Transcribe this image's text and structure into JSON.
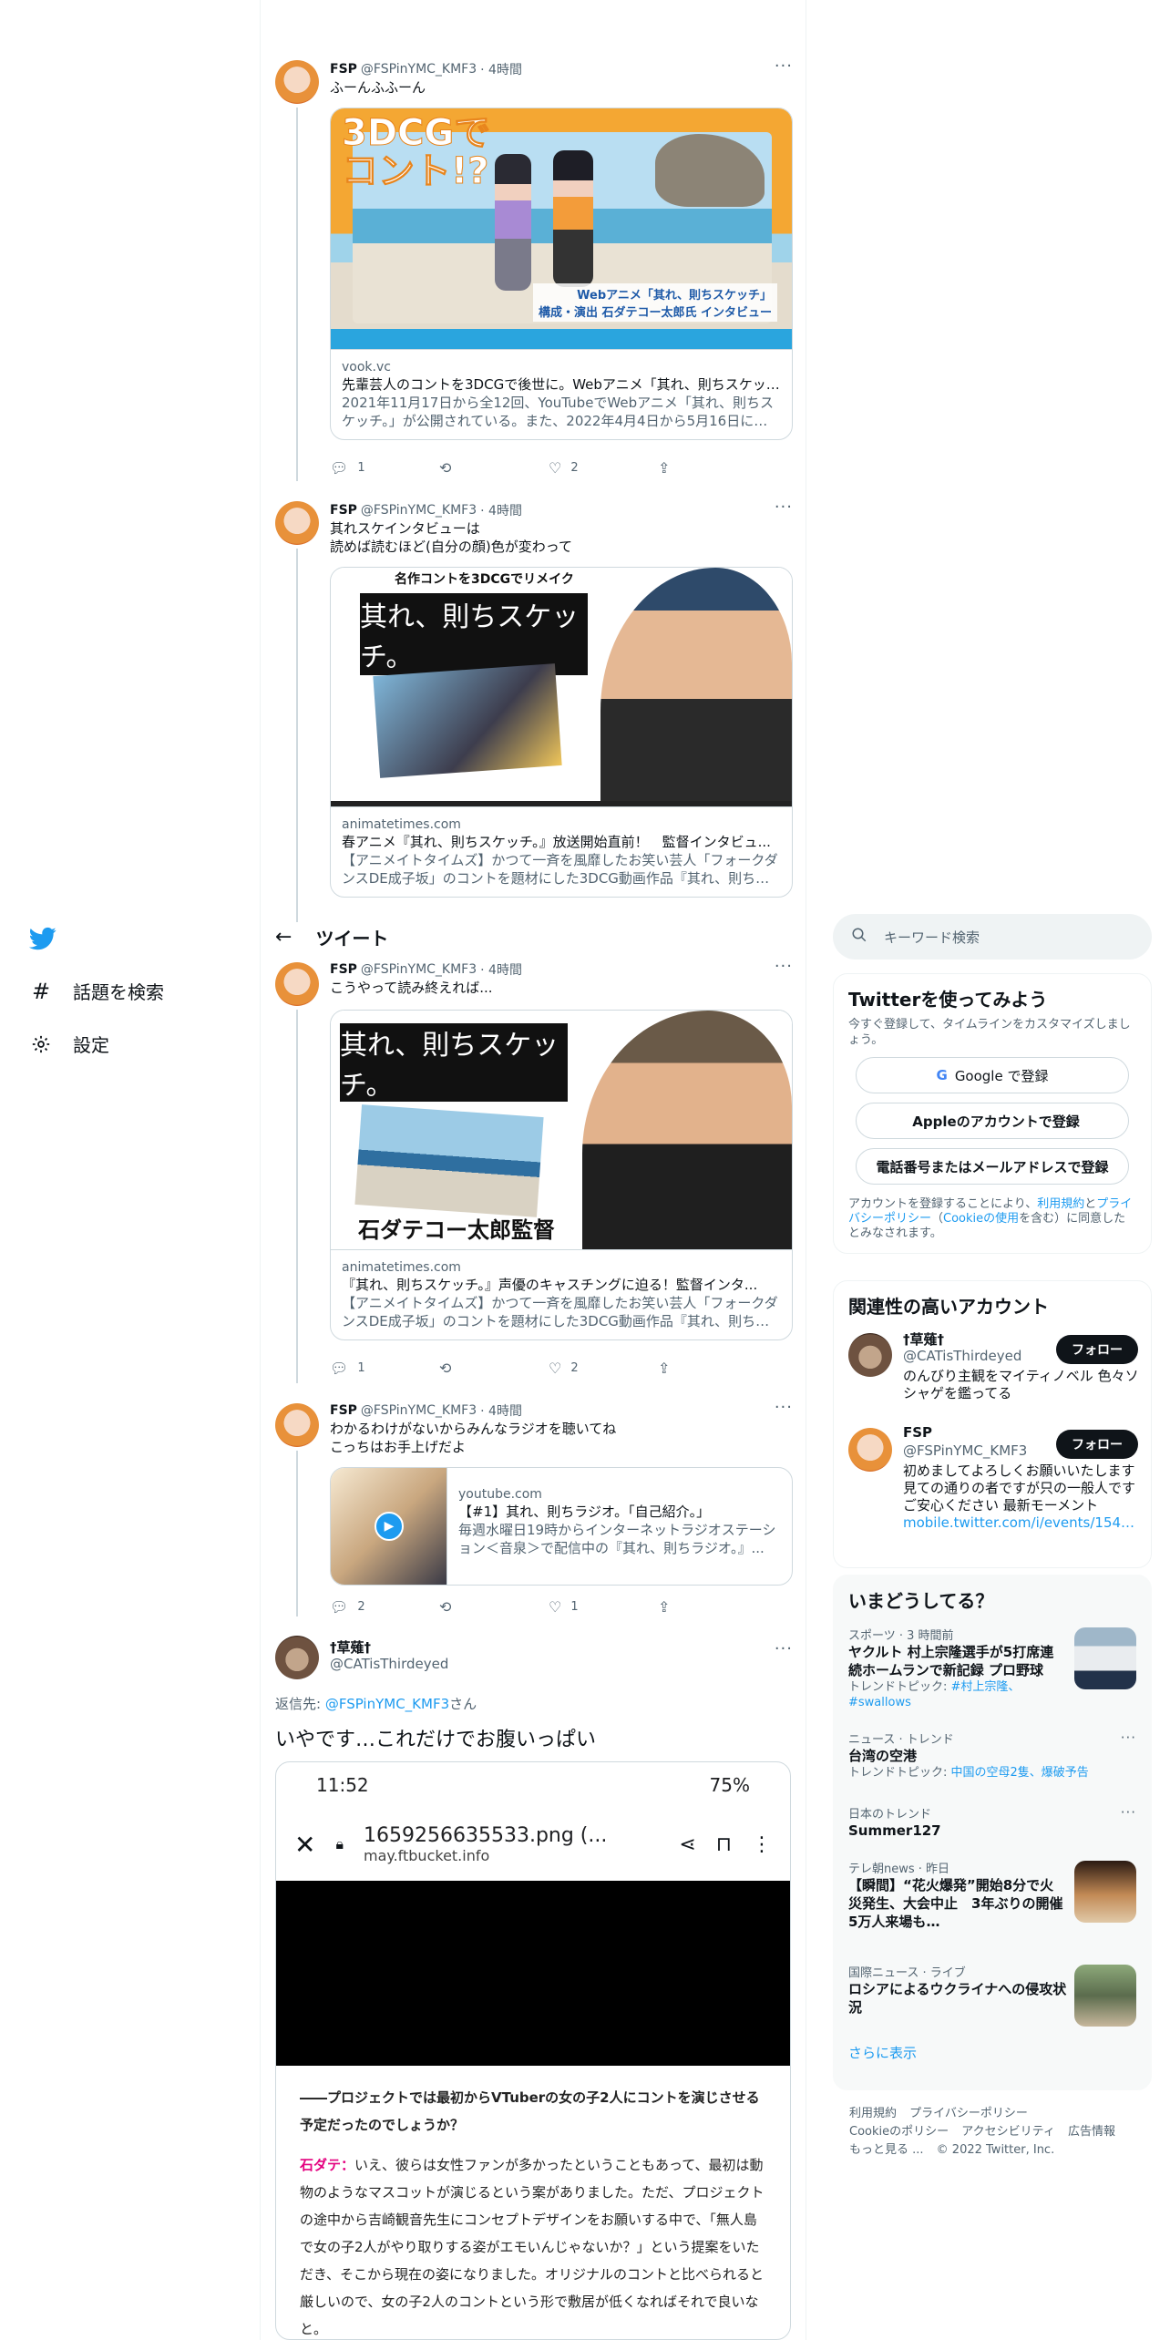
{
  "nav": {
    "items": [
      {
        "icon": "hashtag-icon",
        "label": "話題を検索"
      },
      {
        "icon": "gear-icon",
        "label": "設定"
      }
    ]
  },
  "header": {
    "title": "ツイート"
  },
  "tweets": [
    {
      "name": "FSP",
      "handle": "@FSPinYMC_KMF3",
      "time": "· 4時間",
      "text": "ふーんふふーん",
      "card": {
        "image_text_big": "3DCGで\nコント!?",
        "image_text_sub": "Webアニメ「其れ、則ちスケッチ」\n構成・演出 石ダテコー太郎氏 インタビュー",
        "domain": "vook.vc",
        "title": "先輩芸人のコントを3DCGで後世に。Webアニメ「其れ、則ちスケッチ」...",
        "desc": "2021年11月17日から全12回、YouTubeでWebアニメ「其れ、則ちスケッチ。」が公開されている。また、2022年4月4日から5月16日にかけ..."
      },
      "replies": "1",
      "retweets": "",
      "likes": "2"
    },
    {
      "name": "FSP",
      "handle": "@FSPinYMC_KMF3",
      "time": "· 4時間",
      "text": "其れスケインタビューは\n読めば読むほど(自分の顔)色が変わって",
      "card": {
        "image_banner": "名作コントを3DCGでリメイク",
        "image_logo": "其れ、則ちスケッチ。",
        "domain": "animatetimes.com",
        "title": "春アニメ『其れ、則ちスケッチ。』放送開始直前！　監督インタビュ...",
        "desc": "【アニメイトタイムズ】かつて一斉を風靡したお笑い芸人「フォークダンスDE成子坂」のコントを題材にした3DCG動画作品『其れ、則ちス..."
      }
    },
    {
      "name": "FSP",
      "handle": "@FSPinYMC_KMF3",
      "time": "· 4時間",
      "text": "こうやって読み終えれば...",
      "card": {
        "image_logo": "其れ、則ちスケッチ。",
        "image_caption": "石ダテコー太郎監督",
        "domain": "animatetimes.com",
        "title": "『其れ、則ちスケッチ。』声優のキャスチングに迫る！監督インタ...",
        "desc": "【アニメイトタイムズ】かつて一斉を風靡したお笑い芸人「フォークダンスDE成子坂」のコントを題材にした3DCG動画作品『其れ、則ちス..."
      },
      "replies": "1",
      "retweets": "",
      "likes": "2"
    },
    {
      "name": "FSP",
      "handle": "@FSPinYMC_KMF3",
      "time": "· 4時間",
      "text": "わかるわけがないからみんなラジオを聴いてね\nこっちはお手上げだよ",
      "card": {
        "domain": "youtube.com",
        "title": "【#1】其れ、則ちラジオ。「自己紹介。」",
        "desc": "毎週水曜日19時からインターネットラジオステーション＜音泉＞で配信中の『其れ、則ちラジオ。』..."
      },
      "replies": "2",
      "retweets": "",
      "likes": "1"
    }
  ],
  "main_tweet": {
    "name": "†草薙†",
    "handle": "@CATisThirdeyed",
    "reply_prefix": "返信先: ",
    "reply_to": "@FSPinYMC_KMF3",
    "reply_suffix": "さん",
    "text": "いやです…これだけでお腹いっぱい",
    "screenshot": {
      "time": "11:52",
      "status_right": "75%",
      "url_title": "1659256635533.png (...",
      "url_domain": "may.ftbucket.info",
      "question": "――プロジェクトでは最初からVTuberの女の子2人にコントを演じさせる予定だったのでしょうか？",
      "speaker": "石ダテ：",
      "answer": "いえ、彼らは女性ファンが多かったということもあって、最初は動物のようなマスコットが演じるという案がありました。ただ、プロジェクトの途中から吉崎観音先生にコンセプトデザインをお願いする中で、「無人島で女の子2人がやり取りする姿がエモいんじゃないか？」という提案をいただき、そこから現在の姿になりました。オリジナルのコントと比べられると厳しいので、女の子2人のコントという形で敷居が低くなればそれで良いなと。"
    }
  },
  "search": {
    "placeholder": "キーワード検索"
  },
  "signup": {
    "title": "Twitterを使ってみよう",
    "subtitle": "今すぐ登録して、タイムラインをカスタマイズしましょう。",
    "google": "Google で登録",
    "apple": "Appleのアカウントで登録",
    "phone": "電話番号またはメールアドレスで登録",
    "legal_1": "アカウントを登録することにより、",
    "legal_terms": "利用規約",
    "legal_2": "と",
    "legal_privacy": "プライバシーポリシー",
    "legal_3": "（",
    "legal_cookie": "Cookieの使用",
    "legal_4": "を含む）に同意したとみなされます。"
  },
  "related": {
    "title": "関連性の高いアカウント",
    "accounts": [
      {
        "name": "†草薙†",
        "handle": "@CATisThirdeyed",
        "bio": "のんびり主観をマイティノベル 色々ソシャゲを鑑ってる",
        "link": "",
        "button": "フォロー"
      },
      {
        "name": "FSP",
        "handle": "@FSPinYMC_KMF3",
        "bio": "初めましてよろしくお願いいたします 見ての通りの者ですが只の一般人です ご安心ください 最新モーメント",
        "link": "mobile.twitter.com/i/events/15477...",
        "button": "フォロー"
      }
    ]
  },
  "trends": {
    "title": "いまどうしてる？",
    "items": [
      {
        "meta": "スポーツ · 3 時間前",
        "title": "ヤクルト 村上宗隆選手が5打席連続ホームランで新記録 プロ野球",
        "sub_prefix": "トレンドトピック: ",
        "sub_links": "#村上宗隆、#swallows",
        "thumb": true
      },
      {
        "meta": "ニュース · トレンド",
        "title": "台湾の空港",
        "sub_prefix": "トレンドトピック: ",
        "sub_links": "中国の空母2隻、爆破予告",
        "thumb": false
      },
      {
        "meta": "日本のトレンド",
        "title": "Summer127",
        "sub_prefix": "",
        "sub_links": "",
        "thumb": false
      },
      {
        "meta": "テレ朝news · 昨日",
        "title": "【瞬間】“花火爆発”開始8分で火災発生、大会中止　3年ぶりの開催 5万人来場も…",
        "sub_prefix": "",
        "sub_links": "",
        "thumb": true
      },
      {
        "meta": "国際ニュース · ライブ",
        "title": "ロシアによるウクライナへの侵攻状況",
        "sub_prefix": "",
        "sub_links": "",
        "thumb": true
      }
    ],
    "show_more": "さらに表示"
  },
  "footer": {
    "links": [
      "利用規約",
      "プライバシーポリシー",
      "Cookieのポリシー",
      "アクセシビリティ",
      "広告情報",
      "もっと見る ...",
      "© 2022 Twitter, Inc."
    ]
  },
  "colors": {
    "accent": "#1d9bf0",
    "text": "#0f1419",
    "muted": "#536471"
  }
}
